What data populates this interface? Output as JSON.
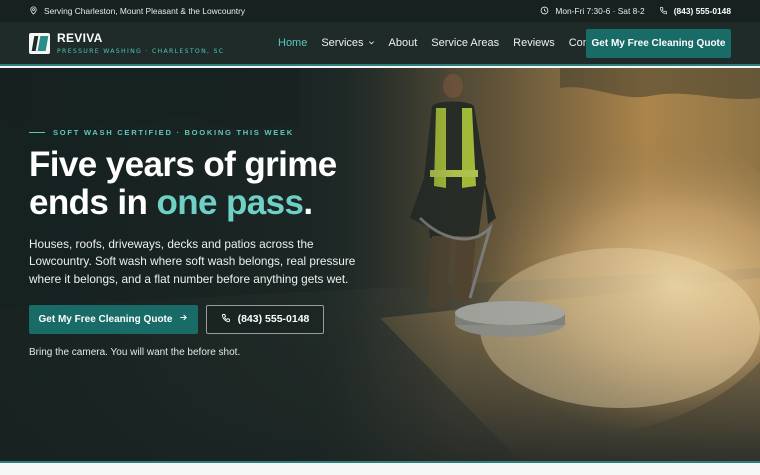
{
  "topbar": {
    "service_area": "Serving Charleston, Mount Pleasant & the Lowcountry",
    "hours": "Mon-Fri 7:30-6 · Sat 8-2",
    "phone": "(843) 555-0148"
  },
  "brand": {
    "name": "REVIVA",
    "tagline": "PRESSURE WASHING · CHARLESTON, SC"
  },
  "nav": {
    "items": [
      {
        "label": "Home",
        "active": true
      },
      {
        "label": "Services",
        "dropdown": true
      },
      {
        "label": "About"
      },
      {
        "label": "Service Areas"
      },
      {
        "label": "Reviews"
      },
      {
        "label": "Contact"
      }
    ],
    "cta_label": "Get My Free Cleaning Quote"
  },
  "hero": {
    "eyebrow": "SOFT WASH CERTIFIED · BOOKING THIS WEEK",
    "headline_line1": "Five years of grime",
    "headline_line2_a": "ends in ",
    "headline_line2_accent": "one pass",
    "headline_line2_b": ".",
    "subtext": "Houses, roofs, driveways, decks and patios across the Lowcountry. Soft wash where soft wash belongs, real pressure where it belongs, and a flat number before anything gets wet.",
    "primary_cta": "Get My Free Cleaning Quote",
    "phone_cta": "(843) 555-0148",
    "note": "Bring the camera. You will want the before shot."
  },
  "colors": {
    "accent": "#186b67",
    "accent_light": "#6fd0c6",
    "header_bg": "#1e2b29",
    "topbar_bg": "#17211f"
  },
  "icons": [
    "location-pin-icon",
    "clock-icon",
    "phone-icon",
    "chevron-down-icon",
    "arrow-right-icon"
  ]
}
